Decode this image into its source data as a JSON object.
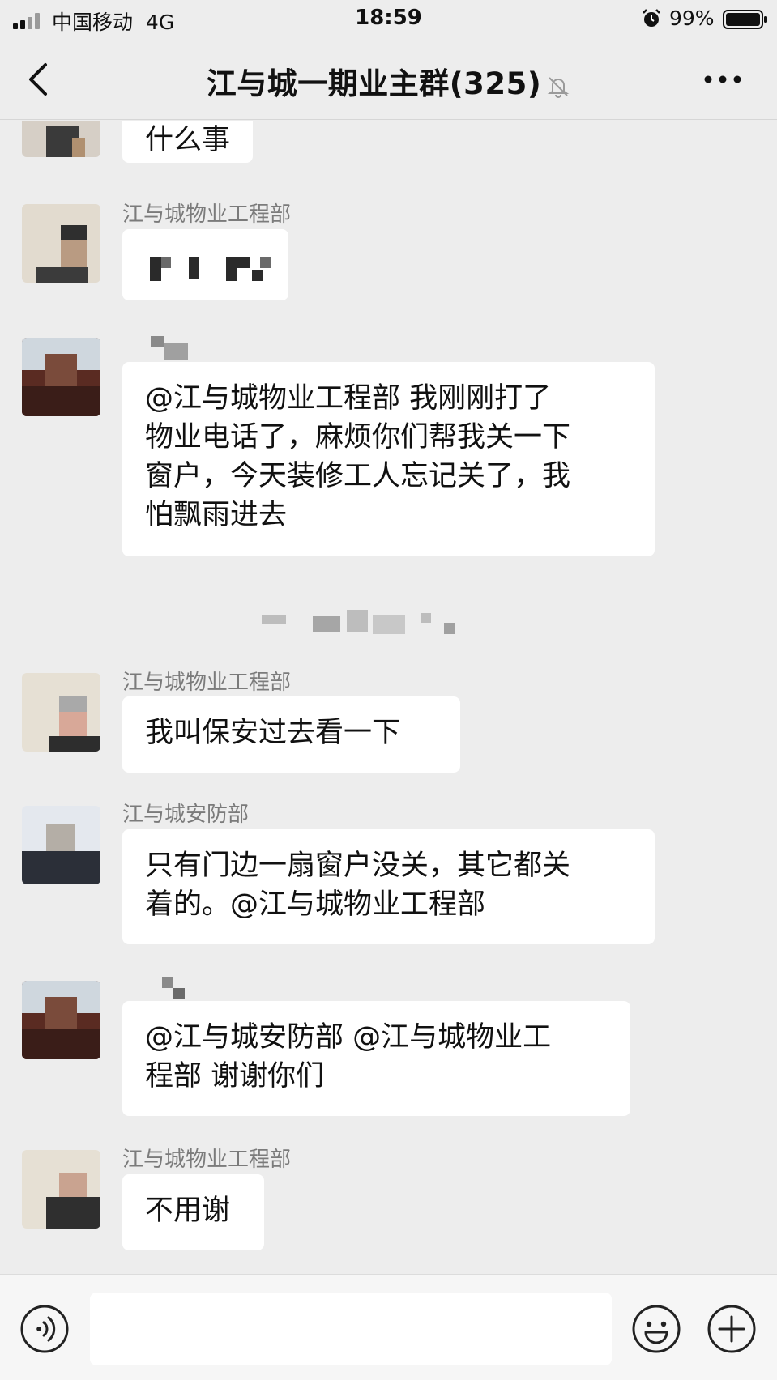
{
  "status_bar": {
    "carrier": "中国移动",
    "network": "4G",
    "time": "18:59",
    "battery": "99%"
  },
  "nav": {
    "title": "江与城一期业主群(325)"
  },
  "messages": [
    {
      "sender": "",
      "text": "什么事"
    },
    {
      "sender": "江与城物业工程部",
      "text": ""
    },
    {
      "sender": "",
      "text": "@江与城物业工程部 我刚刚打了\n物业电话了，麻烦你们帮我关一下\n窗户，今天装修工人忘记关了，我\n怕飘雨进去"
    },
    {
      "sender": "江与城物业工程部",
      "text": "我叫保安过去看一下"
    },
    {
      "sender": "江与城安防部",
      "text": "只有门边一扇窗户没关，其它都关\n着的。@江与城物业工程部"
    },
    {
      "sender": "",
      "text": "@江与城安防部 @江与城物业工\n程部 谢谢你们"
    },
    {
      "sender": "江与城物业工程部",
      "text": "不用谢"
    }
  ],
  "input": {
    "placeholder": ""
  },
  "icons": [
    "signal-icon",
    "alarm-icon",
    "battery-icon",
    "back-icon",
    "mute-icon",
    "more-icon",
    "voice-icon",
    "emoji-icon",
    "plus-icon"
  ]
}
